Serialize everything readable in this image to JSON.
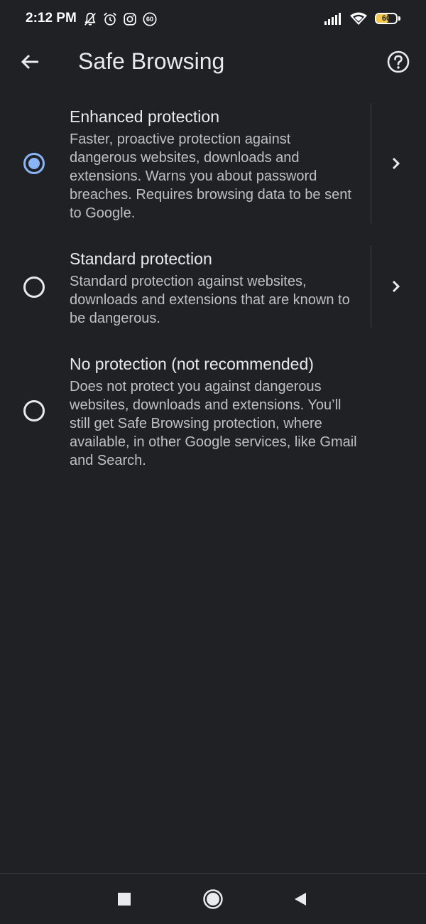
{
  "status_bar": {
    "time": "2:12 PM",
    "battery_level": "60",
    "battery_fraction": 0.6,
    "icons_left": [
      "bell-off-icon",
      "alarm-icon",
      "instagram-icon",
      "notification-60-icon"
    ],
    "notification_badge": "60",
    "icons_right": [
      "signal-icon",
      "wifi-icon",
      "battery-icon"
    ]
  },
  "app_bar": {
    "title": "Safe Browsing",
    "back_icon": "arrow-left-icon",
    "help_icon": "help-circle-icon"
  },
  "options": [
    {
      "title": "Enhanced protection",
      "description": "Faster, proactive protection against dangerous websites, downloads and extensions. Warns you about password breaches. Requires browsing data to be sent to Google.",
      "selected": true,
      "has_details": true
    },
    {
      "title": "Standard protection",
      "description": "Standard protection against websites, downloads and extensions that are known to be dangerous.",
      "selected": false,
      "has_details": true
    },
    {
      "title": "No protection (not recommended)",
      "description": "Does not protect you against dangerous websites, downloads and extensions. You’ll still get Safe Browsing protection, where available, in other Google services, like Gmail and Search.",
      "selected": false,
      "has_details": false
    }
  ],
  "nav_bar": {
    "items": [
      "recents-square-icon",
      "home-circle-icon",
      "back-triangle-icon"
    ]
  },
  "colors": {
    "background": "#202124",
    "accent": "#8ab4f8",
    "text_primary": "#e8eaed",
    "text_secondary": "#bdc1c6",
    "battery_fill": "#f2c94c"
  }
}
